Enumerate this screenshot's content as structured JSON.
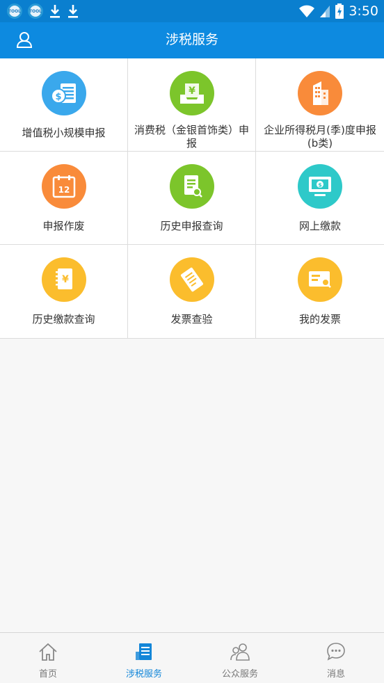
{
  "status_bar": {
    "time": "3:50",
    "app_icon_text": "TOOL",
    "icons": [
      "app-icon",
      "app-icon",
      "download-icon",
      "download-icon",
      "wifi-icon",
      "signal-icon",
      "battery-icon"
    ]
  },
  "header": {
    "title": "涉税服务",
    "left_icon": "user-icon"
  },
  "services": [
    {
      "label": "增值税小规模申报",
      "icon": "money-stack-icon",
      "color": "#3aa8ec"
    },
    {
      "label": "消费税（金银首饰类）申报",
      "icon": "yen-tray-icon",
      "color": "#7cc52b"
    },
    {
      "label": "企业所得税月(季)度申报(b类)",
      "icon": "building-icon",
      "color": "#f98b3a"
    },
    {
      "label": "申报作废",
      "icon": "calendar-icon",
      "color": "#f98b3a"
    },
    {
      "label": "历史申报查询",
      "icon": "document-search-icon",
      "color": "#7cc52b"
    },
    {
      "label": "网上缴款",
      "icon": "monitor-payment-icon",
      "color": "#2ec9c9"
    },
    {
      "label": "历史缴款查询",
      "icon": "yen-notebook-icon",
      "color": "#fbbd2d"
    },
    {
      "label": "发票查验",
      "icon": "ticket-icon",
      "color": "#fbbd2d"
    },
    {
      "label": "我的发票",
      "icon": "card-search-icon",
      "color": "#fbbd2d"
    }
  ],
  "tabs": [
    {
      "label": "首页",
      "icon": "home-icon",
      "active": false
    },
    {
      "label": "涉税服务",
      "icon": "document-icon",
      "active": true
    },
    {
      "label": "公众服务",
      "icon": "users-icon",
      "active": false
    },
    {
      "label": "消息",
      "icon": "chat-icon",
      "active": false
    }
  ],
  "colors": {
    "status_bar": "#0a7fcf",
    "header": "#0d8ae0",
    "active_tab": "#1386d8",
    "inactive_tab": "#777777"
  }
}
